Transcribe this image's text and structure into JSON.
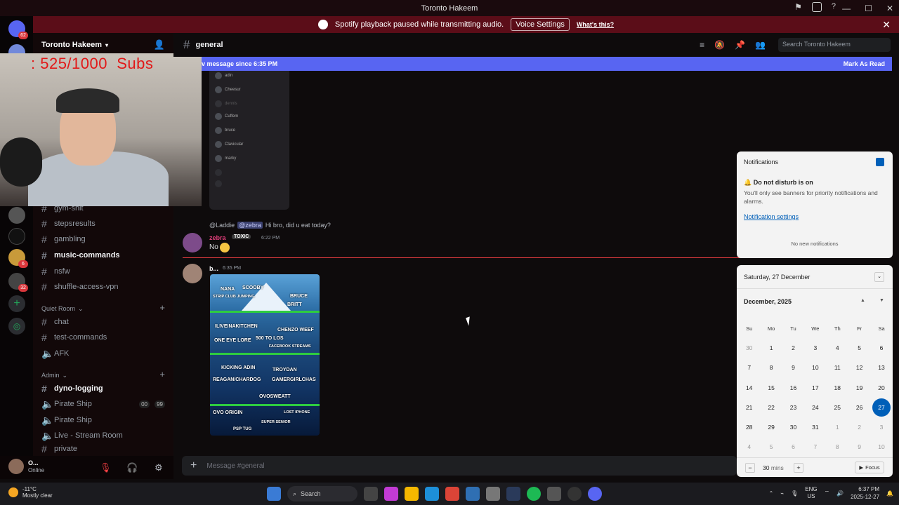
{
  "window": {
    "title": "Toronto Hakeem"
  },
  "banner": {
    "message": "Spotify playback paused while transmitting audio.",
    "button": "Voice Settings",
    "link": "What's this?"
  },
  "servers": [
    {
      "badge": "62"
    },
    {
      "badge": ""
    },
    {
      "badge": ""
    },
    {
      "badge": ""
    },
    {
      "badge": ""
    },
    {
      "badge": "6"
    },
    {
      "badge": "32"
    }
  ],
  "guild": {
    "name": "Toronto Hakeem"
  },
  "overlay": {
    "subs": ": 525/1000  Subs"
  },
  "channels": {
    "list1": [
      {
        "name": "gym-shit",
        "bold": false
      },
      {
        "name": "stepsresults",
        "bold": false
      },
      {
        "name": "gambling",
        "bold": false
      },
      {
        "name": "music-commands",
        "bold": true
      },
      {
        "name": "nsfw",
        "bold": false
      },
      {
        "name": "shuffle-access-vpn",
        "bold": false
      }
    ],
    "cat_quiet": "Quiet Room",
    "quiet": [
      {
        "name": "chat",
        "type": "text"
      },
      {
        "name": "test-commands",
        "type": "text"
      },
      {
        "name": "AFK",
        "type": "voice"
      }
    ],
    "cat_admin": "Admin",
    "admin": [
      {
        "name": "dyno-logging",
        "type": "text",
        "bold": true
      },
      {
        "name": "Pirate Ship",
        "type": "voice",
        "badge1": "00",
        "badge2": "99"
      },
      {
        "name": "Pirate Ship",
        "type": "voice"
      },
      {
        "name": "Live - Stream Room",
        "type": "voice"
      },
      {
        "name": "private",
        "type": "text"
      }
    ]
  },
  "user": {
    "name": "O...",
    "status": "Online"
  },
  "chat": {
    "channel": "general",
    "search_placeholder": "Search Toronto Hakeem",
    "new_messages": "v message since 6:35 PM",
    "mark_read": "Mark As Read",
    "screenshot_rows": [
      "adin",
      "Cheesur",
      "dennis",
      "Cuffem",
      "bruce",
      "Clavicular",
      "marky",
      "",
      ""
    ],
    "reply": {
      "from": "@Laddie",
      "mention": "@zebra",
      "text": "Hi bro, did u eat today?"
    },
    "msg1": {
      "author": "zebra",
      "tag": "TOXIC",
      "time": "6:22 PM",
      "text": "No"
    },
    "msg2": {
      "author": "b...",
      "time": "6:35 PM"
    },
    "composer_placeholder": "Message #general"
  },
  "iceberg": {
    "labels": [
      "NANA",
      "SCOOBY",
      "STRIP CLUB JUMPING",
      "BRUCE",
      "BRITT",
      "ILIVEINAKITCHEN",
      "CHENZO WEEF",
      "ONE EYE LORE",
      "500 TO LOS",
      "FACEBOOK STREAMS",
      "KICKING ADIN",
      "TROYDAN",
      "REAGAN/CHARDOG",
      "GAMERGIRLCHAS",
      "OVOSWEATT",
      "OVO ORIGIN",
      "LOST IPHONE",
      "SUPER SENIOR",
      "PSP TUG"
    ]
  },
  "notifications": {
    "title": "Notifications",
    "dnd": "Do not disturb is on",
    "dnd_desc": "You'll only see banners for priority notifications and alarms.",
    "settings": "Notification settings",
    "none": "No new notifications"
  },
  "calendar": {
    "date": "Saturday, 27 December",
    "month": "December, 2025",
    "weekdays": [
      "Su",
      "Mo",
      "Tu",
      "We",
      "Th",
      "Fr",
      "Sa"
    ],
    "days": [
      30,
      1,
      2,
      3,
      4,
      5,
      6,
      7,
      8,
      9,
      10,
      11,
      12,
      13,
      14,
      15,
      16,
      17,
      18,
      19,
      20,
      21,
      22,
      23,
      24,
      25,
      26,
      27,
      28,
      29,
      30,
      31,
      1,
      2,
      3,
      4,
      5,
      6,
      7,
      8,
      9,
      10
    ],
    "today": 27,
    "focus_mins": "30",
    "focus_unit": "mins",
    "focus_label": "Focus"
  },
  "taskbar": {
    "temp": "-11°C",
    "weather": "Mostly clear",
    "search": "Search",
    "lang1": "ENG",
    "lang2": "US",
    "time": "6:37 PM",
    "date": "2025-12-27"
  }
}
